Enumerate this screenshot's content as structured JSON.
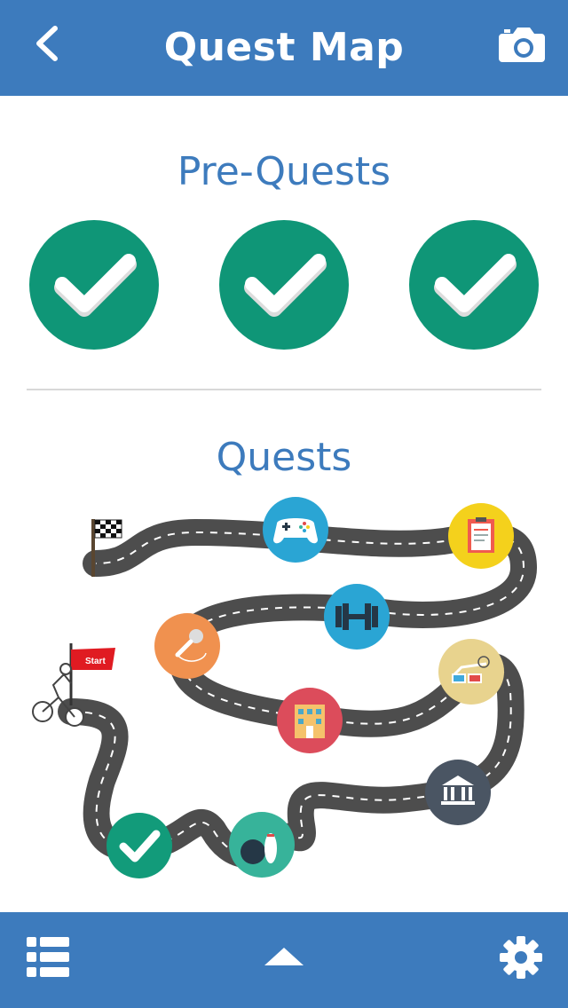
{
  "header": {
    "title": "Quest Map",
    "back_icon": "chevron-left-icon",
    "camera_icon": "camera-icon"
  },
  "pre_quests": {
    "title": "Pre-Quests",
    "items": [
      {
        "status": "completed",
        "icon": "checkmark-icon"
      },
      {
        "status": "completed",
        "icon": "checkmark-icon"
      },
      {
        "status": "completed",
        "icon": "checkmark-icon"
      }
    ]
  },
  "quests": {
    "title": "Quests",
    "start_label": "Start",
    "nodes": [
      {
        "icon": "checkmark-icon",
        "status": "completed",
        "color": "#129b7a"
      },
      {
        "icon": "bowling-icon",
        "color": "#37b39a"
      },
      {
        "icon": "museum-icon",
        "color": "#4a5563"
      },
      {
        "icon": "3d-glasses-icon",
        "color": "#e8d38e"
      },
      {
        "icon": "building-icon",
        "color": "#dc4c5b"
      },
      {
        "icon": "microphone-icon",
        "color": "#f0914f"
      },
      {
        "icon": "dumbbell-icon",
        "color": "#2aa5d4"
      },
      {
        "icon": "clipboard-icon",
        "color": "#f4d11c"
      },
      {
        "icon": "gamepad-icon",
        "color": "#2aa5d4"
      }
    ],
    "start_icon": "cyclist-icon",
    "finish_icon": "checkered-flag-icon"
  },
  "footer": {
    "list_icon": "list-icon",
    "up_icon": "triangle-up-icon",
    "settings_icon": "gear-icon"
  },
  "colors": {
    "brand": "#3d7bbd",
    "check_green": "#0f9677",
    "road": "#555555"
  }
}
